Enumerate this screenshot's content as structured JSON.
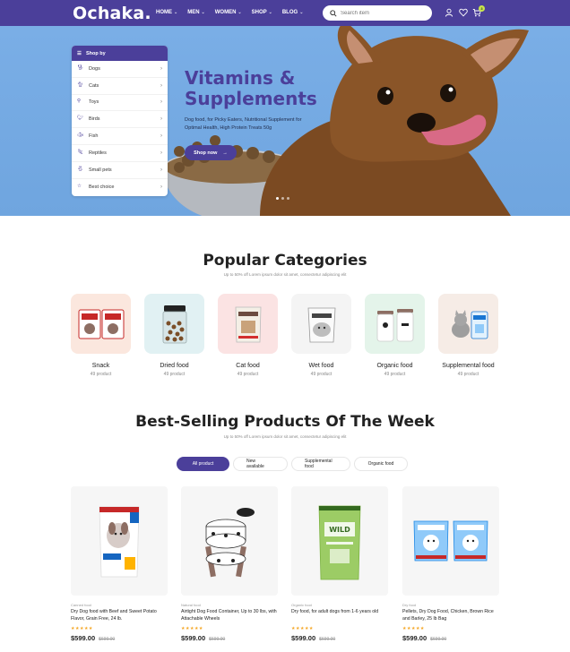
{
  "header": {
    "logo": "Ochaka.",
    "nav": [
      {
        "label": "HOME"
      },
      {
        "label": "MEN"
      },
      {
        "label": "WOMEN"
      },
      {
        "label": "SHOP"
      },
      {
        "label": "BLOG"
      }
    ],
    "search_placeholder": "Search item",
    "cart_count": "3"
  },
  "hero": {
    "title_line1": "Vitamins &",
    "title_line2": "Supplements",
    "description": "Dog food, for Picky Eaters, Nutritional Supplement for Optimal Health, High Protein Treats 50g",
    "button": "Shop now"
  },
  "shop_by": {
    "title": "Shop by",
    "items": [
      {
        "label": "Dogs"
      },
      {
        "label": "Cats"
      },
      {
        "label": "Toys"
      },
      {
        "label": "Birds"
      },
      {
        "label": "Fish"
      },
      {
        "label": "Reptiles"
      },
      {
        "label": "Small pets"
      },
      {
        "label": "Best choice"
      }
    ]
  },
  "categories_section": {
    "title": "Popular Categories",
    "subtitle": "Up to 50% off Lorem ipsum dolor sit amet, consectetur adipiscing elit",
    "items": [
      {
        "name": "Snack",
        "count": "49 product",
        "bg": "#fbe7de"
      },
      {
        "name": "Dried food",
        "count": "49 product",
        "bg": "#e1f1f3"
      },
      {
        "name": "Cat food",
        "count": "49 product",
        "bg": "#fbe3e3"
      },
      {
        "name": "Wet food",
        "count": "49 product",
        "bg": "#f4f4f4"
      },
      {
        "name": "Organic food",
        "count": "49 product",
        "bg": "#e4f4ea"
      },
      {
        "name": "Supplemental food",
        "count": "49 product",
        "bg": "#f6ece6"
      }
    ]
  },
  "products_section": {
    "title": "Best-Selling Products Of The Week",
    "subtitle": "Up to 50% off Lorem ipsum dolor sit amet, consectetur adipiscing elit",
    "tabs": [
      {
        "label": "All product"
      },
      {
        "label": "New available"
      },
      {
        "label": "Supplemental food"
      },
      {
        "label": "Organic food"
      }
    ],
    "products": [
      {
        "category": "Canned food",
        "name": "Dry Dog food with Beef and Sweet Potato Flavor, Grain Free, 24 lb.",
        "stars": "★★★★★",
        "price": "$599.00",
        "old_price": "$699.00"
      },
      {
        "category": "Natural food",
        "name": "Airtight Dog Food Container, Up to 30 lbs, with Attachable Wheels",
        "stars": "★★★★★",
        "price": "$599.00",
        "old_price": "$699.00"
      },
      {
        "category": "Organic food",
        "name": "Dry food, for adult dogs from 1-6 years old",
        "stars": "★★★★★",
        "price": "$599.00",
        "old_price": "$699.00"
      },
      {
        "category": "Dry food",
        "name": "Pellets, Dry Dog Food, Chicken, Brown Rice and Barley, 25 lb Bag",
        "stars": "★★★★★",
        "price": "$599.00",
        "old_price": "$699.00"
      }
    ]
  },
  "colors": {
    "brand": "#4b3f9a",
    "accent": "#c8e64b",
    "star": "#f5a623"
  }
}
